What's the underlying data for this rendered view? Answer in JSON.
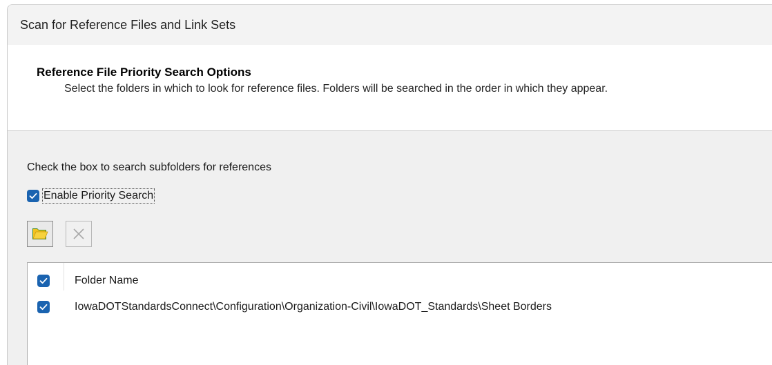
{
  "window": {
    "title": "Scan for Reference Files and Link Sets"
  },
  "header": {
    "title": "Reference File Priority Search Options",
    "description": "Select the folders in which to look for reference files.  Folders will be searched in the order in which they appear."
  },
  "body": {
    "instruction": "Check the box to search subfolders for references",
    "enable_priority_search": {
      "label": "Enable Priority Search",
      "checked": true
    },
    "toolbar": {
      "add_folder_icon": "folder-add-icon",
      "remove_icon": "remove-x-icon"
    },
    "folder_list": {
      "header": {
        "label": "Folder Name",
        "checked": true
      },
      "rows": [
        {
          "label": "IowaDOTStandardsConnect\\Configuration\\Organization-Civil\\IowaDOT_Standards\\Sheet Borders",
          "checked": true
        }
      ]
    }
  },
  "colors": {
    "checkbox_blue": "#1a63b0",
    "folder_yellow": "#f2c21b",
    "folder_green": "#3e8b2c"
  }
}
